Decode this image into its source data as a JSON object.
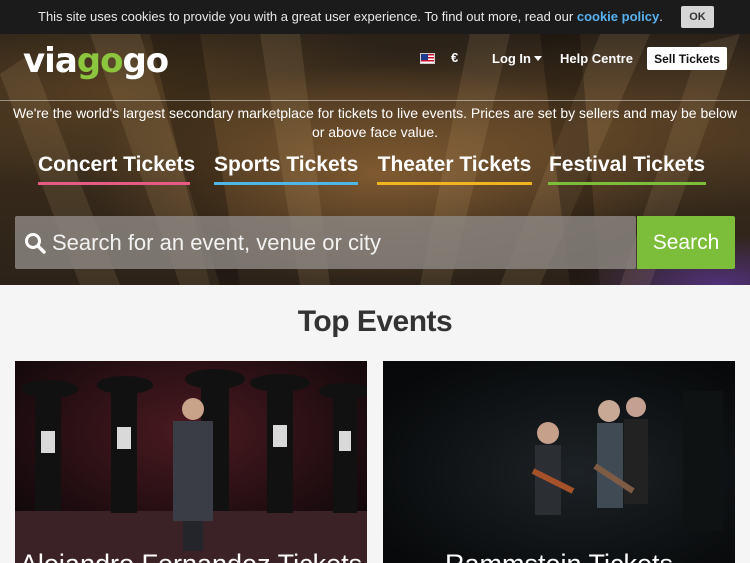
{
  "cookie_bar": {
    "text": "This site uses cookies to provide you with a great user experience. To find out more, read our",
    "link": "cookie policy",
    "trailing": ".",
    "ok_label": "OK"
  },
  "header": {
    "logo_prefix": "via",
    "logo_go": "go",
    "logo_suffix": "go",
    "flag": "us-flag-icon",
    "currency": "€",
    "login_label": "Log In",
    "help_label": "Help Centre",
    "sell_label": "Sell Tickets"
  },
  "hero": {
    "tagline": "We're the world's largest secondary marketplace for tickets to live events. Prices are set by sellers and may be below or above face value.",
    "categories": [
      {
        "label": "Concert Tickets",
        "color": "#e85a86"
      },
      {
        "label": "Sports Tickets",
        "color": "#4fb6e8"
      },
      {
        "label": "Theater Tickets",
        "color": "#f2b51f"
      },
      {
        "label": "Festival Tickets",
        "color": "#7cbd3a"
      }
    ],
    "search_placeholder": "Search for an event, venue or city",
    "search_button": "Search"
  },
  "top_events": {
    "title": "Top Events",
    "cards": [
      {
        "caption": "Alejandro Fernandez Tickets"
      },
      {
        "caption": "Rammstein Tickets"
      }
    ]
  },
  "colors": {
    "accent_green": "#7cbd3a",
    "cookie_link": "#56b2f0"
  }
}
